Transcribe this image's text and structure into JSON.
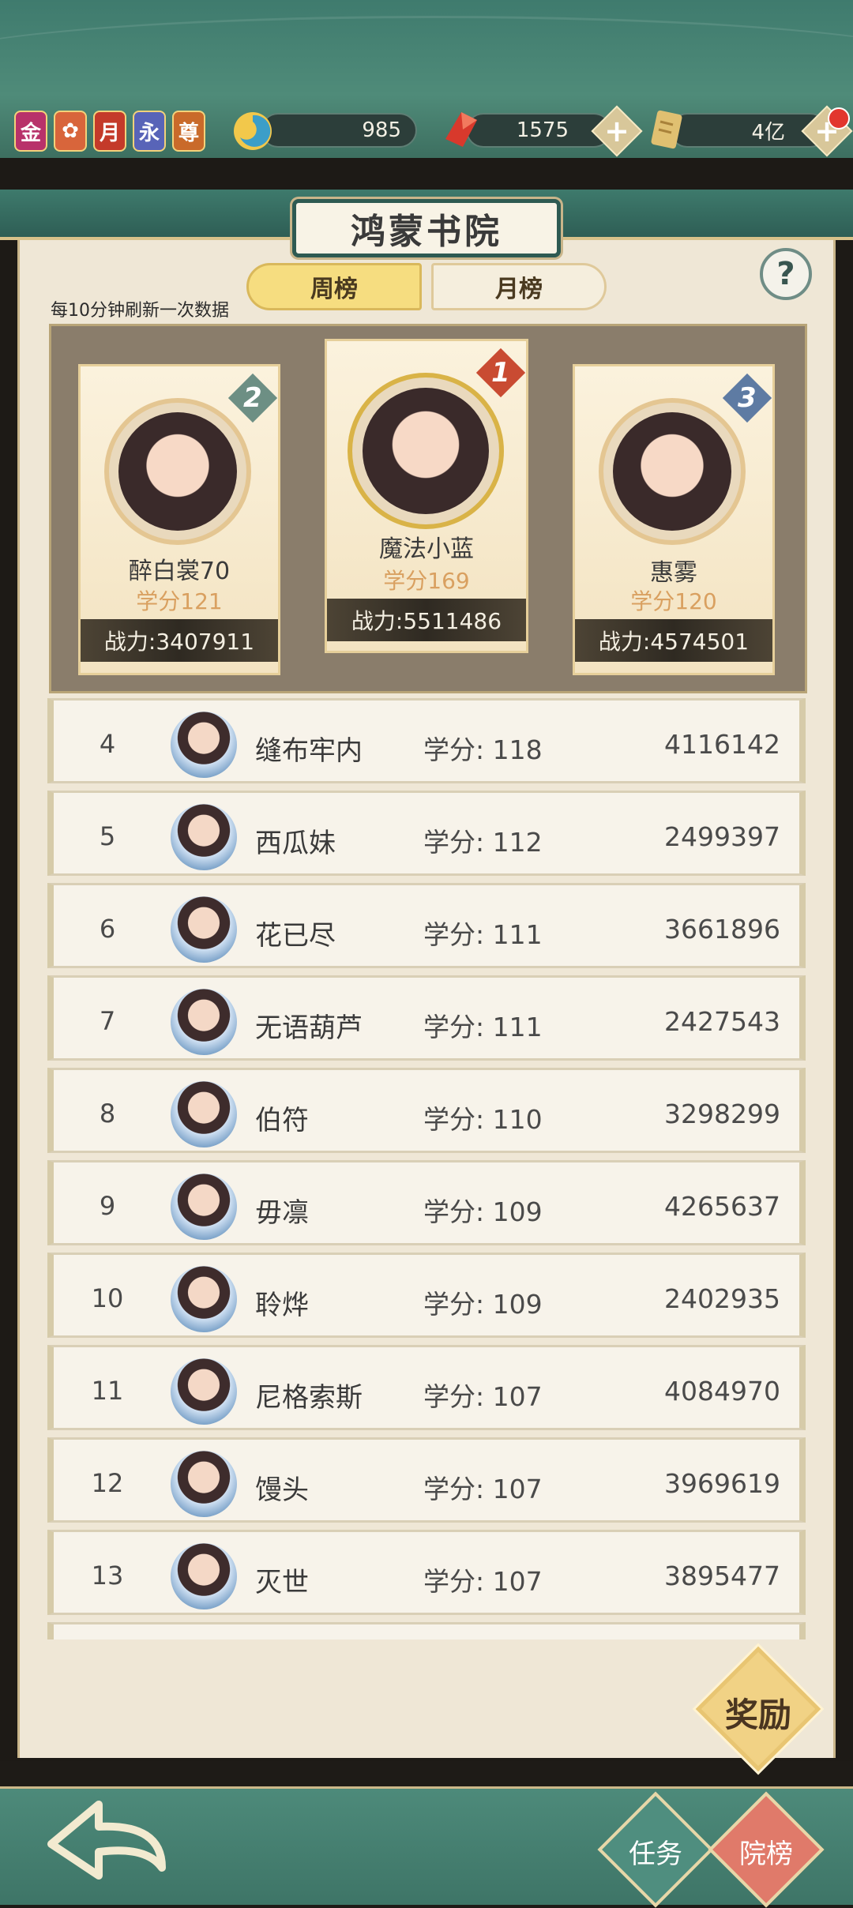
{
  "topbar": {
    "vip_badges": [
      "金",
      "",
      "月",
      "永",
      "尊"
    ],
    "resources": [
      {
        "icon": "swirl-icon",
        "value": "985"
      },
      {
        "icon": "red-crystal-icon",
        "value": "1575"
      },
      {
        "icon": "scroll-icon",
        "value": "4亿"
      }
    ],
    "plus_label": "+"
  },
  "header": {
    "title": "鸿蒙书院",
    "tabs": [
      {
        "label": "周榜",
        "active": true
      },
      {
        "label": "月榜",
        "active": false
      }
    ],
    "help_label": "?",
    "refresh_note": "每10分钟刷新一次数据"
  },
  "podium": {
    "first": {
      "rank": "1",
      "name": "魔法小蓝",
      "score": "学分169",
      "power": "战力:5511486"
    },
    "second": {
      "rank": "2",
      "name": "醉白裳70",
      "score": "学分121",
      "power": "战力:3407911"
    },
    "third": {
      "rank": "3",
      "name": "惠雾",
      "score": "学分120",
      "power": "战力:4574501"
    }
  },
  "score_prefix": "学分:",
  "list": [
    {
      "rank": "4",
      "name": "缝布牢内",
      "score": "118",
      "power": "4116142"
    },
    {
      "rank": "5",
      "name": "西瓜妹",
      "score": "112",
      "power": "2499397"
    },
    {
      "rank": "6",
      "name": "花已尽",
      "score": "111",
      "power": "3661896"
    },
    {
      "rank": "7",
      "name": "无语葫芦",
      "score": "111",
      "power": "2427543"
    },
    {
      "rank": "8",
      "name": "伯符",
      "score": "110",
      "power": "3298299"
    },
    {
      "rank": "9",
      "name": "毋凛",
      "score": "109",
      "power": "4265637"
    },
    {
      "rank": "10",
      "name": "聆烨",
      "score": "109",
      "power": "2402935"
    },
    {
      "rank": "11",
      "name": "尼格索斯",
      "score": "107",
      "power": "4084970"
    },
    {
      "rank": "12",
      "name": "馒头",
      "score": "107",
      "power": "3969619"
    },
    {
      "rank": "13",
      "name": "灭世",
      "score": "107",
      "power": "3895477"
    }
  ],
  "reward_label": "奖励",
  "bottom": {
    "back_icon": "back-arrow-icon",
    "task_label": "任务",
    "rank_label": "院榜"
  },
  "colors": {
    "teal": "#3f7b6e",
    "gold": "#f6dd80",
    "score_orange": "#d9a060",
    "task_teal": "#4f8e7f",
    "rank_red": "#e07a6a"
  }
}
